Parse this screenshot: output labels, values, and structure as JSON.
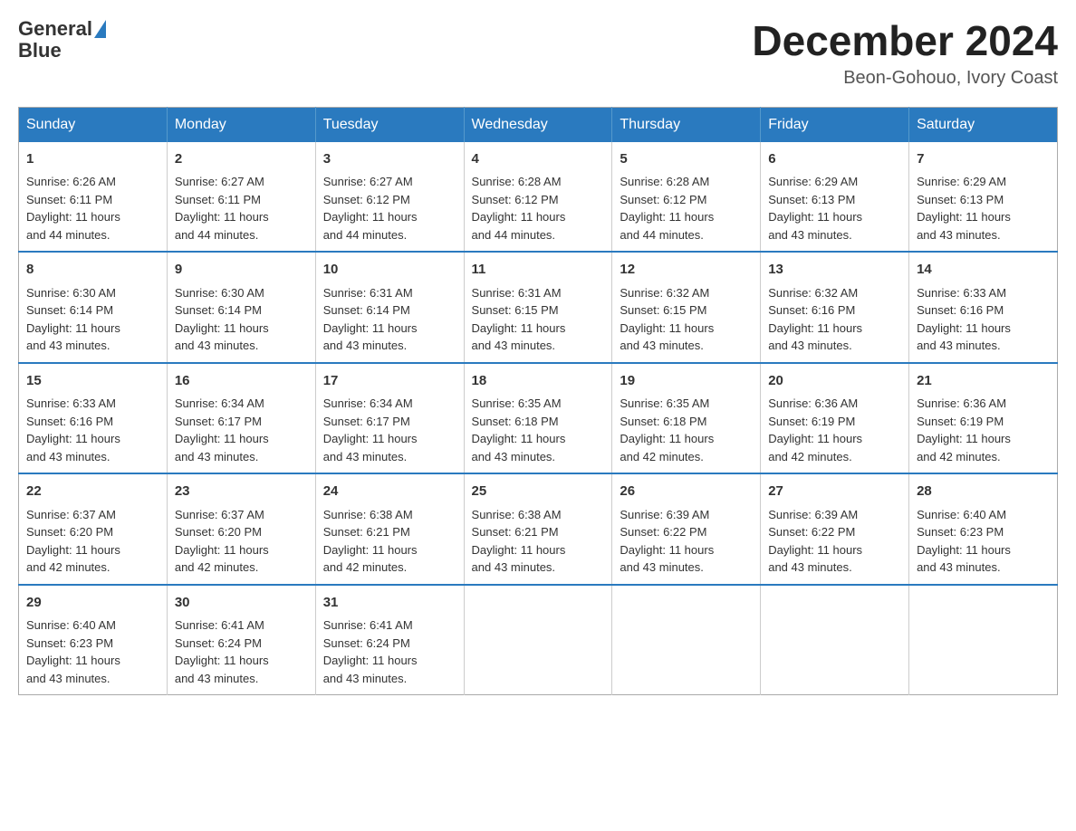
{
  "logo": {
    "text_general": "General",
    "text_blue": "Blue",
    "aria": "GeneralBlue logo"
  },
  "header": {
    "month_year": "December 2024",
    "location": "Beon-Gohouo, Ivory Coast"
  },
  "weekdays": [
    "Sunday",
    "Monday",
    "Tuesday",
    "Wednesday",
    "Thursday",
    "Friday",
    "Saturday"
  ],
  "weeks": [
    [
      {
        "day": "1",
        "sunrise": "6:26 AM",
        "sunset": "6:11 PM",
        "daylight": "11 hours and 44 minutes."
      },
      {
        "day": "2",
        "sunrise": "6:27 AM",
        "sunset": "6:11 PM",
        "daylight": "11 hours and 44 minutes."
      },
      {
        "day": "3",
        "sunrise": "6:27 AM",
        "sunset": "6:12 PM",
        "daylight": "11 hours and 44 minutes."
      },
      {
        "day": "4",
        "sunrise": "6:28 AM",
        "sunset": "6:12 PM",
        "daylight": "11 hours and 44 minutes."
      },
      {
        "day": "5",
        "sunrise": "6:28 AM",
        "sunset": "6:12 PM",
        "daylight": "11 hours and 44 minutes."
      },
      {
        "day": "6",
        "sunrise": "6:29 AM",
        "sunset": "6:13 PM",
        "daylight": "11 hours and 43 minutes."
      },
      {
        "day": "7",
        "sunrise": "6:29 AM",
        "sunset": "6:13 PM",
        "daylight": "11 hours and 43 minutes."
      }
    ],
    [
      {
        "day": "8",
        "sunrise": "6:30 AM",
        "sunset": "6:14 PM",
        "daylight": "11 hours and 43 minutes."
      },
      {
        "day": "9",
        "sunrise": "6:30 AM",
        "sunset": "6:14 PM",
        "daylight": "11 hours and 43 minutes."
      },
      {
        "day": "10",
        "sunrise": "6:31 AM",
        "sunset": "6:14 PM",
        "daylight": "11 hours and 43 minutes."
      },
      {
        "day": "11",
        "sunrise": "6:31 AM",
        "sunset": "6:15 PM",
        "daylight": "11 hours and 43 minutes."
      },
      {
        "day": "12",
        "sunrise": "6:32 AM",
        "sunset": "6:15 PM",
        "daylight": "11 hours and 43 minutes."
      },
      {
        "day": "13",
        "sunrise": "6:32 AM",
        "sunset": "6:16 PM",
        "daylight": "11 hours and 43 minutes."
      },
      {
        "day": "14",
        "sunrise": "6:33 AM",
        "sunset": "6:16 PM",
        "daylight": "11 hours and 43 minutes."
      }
    ],
    [
      {
        "day": "15",
        "sunrise": "6:33 AM",
        "sunset": "6:16 PM",
        "daylight": "11 hours and 43 minutes."
      },
      {
        "day": "16",
        "sunrise": "6:34 AM",
        "sunset": "6:17 PM",
        "daylight": "11 hours and 43 minutes."
      },
      {
        "day": "17",
        "sunrise": "6:34 AM",
        "sunset": "6:17 PM",
        "daylight": "11 hours and 43 minutes."
      },
      {
        "day": "18",
        "sunrise": "6:35 AM",
        "sunset": "6:18 PM",
        "daylight": "11 hours and 43 minutes."
      },
      {
        "day": "19",
        "sunrise": "6:35 AM",
        "sunset": "6:18 PM",
        "daylight": "11 hours and 42 minutes."
      },
      {
        "day": "20",
        "sunrise": "6:36 AM",
        "sunset": "6:19 PM",
        "daylight": "11 hours and 42 minutes."
      },
      {
        "day": "21",
        "sunrise": "6:36 AM",
        "sunset": "6:19 PM",
        "daylight": "11 hours and 42 minutes."
      }
    ],
    [
      {
        "day": "22",
        "sunrise": "6:37 AM",
        "sunset": "6:20 PM",
        "daylight": "11 hours and 42 minutes."
      },
      {
        "day": "23",
        "sunrise": "6:37 AM",
        "sunset": "6:20 PM",
        "daylight": "11 hours and 42 minutes."
      },
      {
        "day": "24",
        "sunrise": "6:38 AM",
        "sunset": "6:21 PM",
        "daylight": "11 hours and 42 minutes."
      },
      {
        "day": "25",
        "sunrise": "6:38 AM",
        "sunset": "6:21 PM",
        "daylight": "11 hours and 43 minutes."
      },
      {
        "day": "26",
        "sunrise": "6:39 AM",
        "sunset": "6:22 PM",
        "daylight": "11 hours and 43 minutes."
      },
      {
        "day": "27",
        "sunrise": "6:39 AM",
        "sunset": "6:22 PM",
        "daylight": "11 hours and 43 minutes."
      },
      {
        "day": "28",
        "sunrise": "6:40 AM",
        "sunset": "6:23 PM",
        "daylight": "11 hours and 43 minutes."
      }
    ],
    [
      {
        "day": "29",
        "sunrise": "6:40 AM",
        "sunset": "6:23 PM",
        "daylight": "11 hours and 43 minutes."
      },
      {
        "day": "30",
        "sunrise": "6:41 AM",
        "sunset": "6:24 PM",
        "daylight": "11 hours and 43 minutes."
      },
      {
        "day": "31",
        "sunrise": "6:41 AM",
        "sunset": "6:24 PM",
        "daylight": "11 hours and 43 minutes."
      },
      null,
      null,
      null,
      null
    ]
  ],
  "labels": {
    "sunrise": "Sunrise:",
    "sunset": "Sunset:",
    "daylight": "Daylight:"
  }
}
